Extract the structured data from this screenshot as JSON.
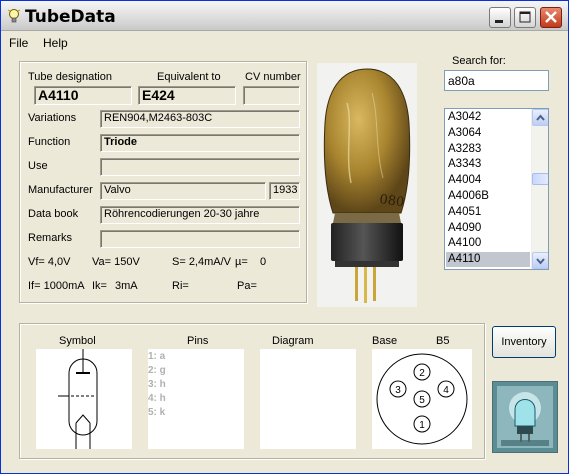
{
  "app": {
    "title": "TubeData"
  },
  "menu": {
    "file": "File",
    "help": "Help"
  },
  "labels": {
    "tube_designation": "Tube designation",
    "equivalent_to": "Equivalent to",
    "cv_number": "CV number",
    "variations": "Variations",
    "function": "Function",
    "use": "Use",
    "manufacturer": "Manufacturer",
    "data_book": "Data book",
    "remarks": "Remarks"
  },
  "fields": {
    "tube_designation": "A4110",
    "equivalent_to": "E424",
    "cv_number": "",
    "variations": "REN904,M2463-803C",
    "function": "Triode",
    "use": "",
    "manufacturer": "Valvo",
    "year": "1933",
    "data_book": "Röhrencodierungen 20-30 jahre",
    "remarks": ""
  },
  "params": {
    "vf": "Vf= 4,0V",
    "va": "Va= 150V",
    "s": "S= 2,4mA/V",
    "mu": "µ=",
    "mu_val": "0",
    "if": "If= 1000mA",
    "ik": "Ik=",
    "ik_val": "3mA",
    "ri": "Ri=",
    "pa": "Pa="
  },
  "search": {
    "label": "Search for:",
    "value": "a80a"
  },
  "tube_list": {
    "items": [
      "A3042",
      "A3064",
      "A3283",
      "A3343",
      "A4004",
      "A4006B",
      "A4051",
      "A4090",
      "A4100",
      "A4110"
    ],
    "selected": "A4110"
  },
  "bottom": {
    "symbol": "Symbol",
    "pins": "Pins",
    "diagram": "Diagram",
    "base": "Base",
    "base_type": "B5",
    "pin_lines": [
      "1: a",
      "2: g",
      "3: h",
      "4: h",
      "5: k"
    ],
    "base_pins": [
      "1",
      "2",
      "3",
      "4",
      "5"
    ]
  },
  "buttons": {
    "inventory": "Inventory"
  },
  "tube_photo": {
    "printed_text": "080"
  },
  "colors": {
    "selection": "#c1c6cf",
    "close_button": "#c2391a",
    "title_border": "#0831d9"
  }
}
